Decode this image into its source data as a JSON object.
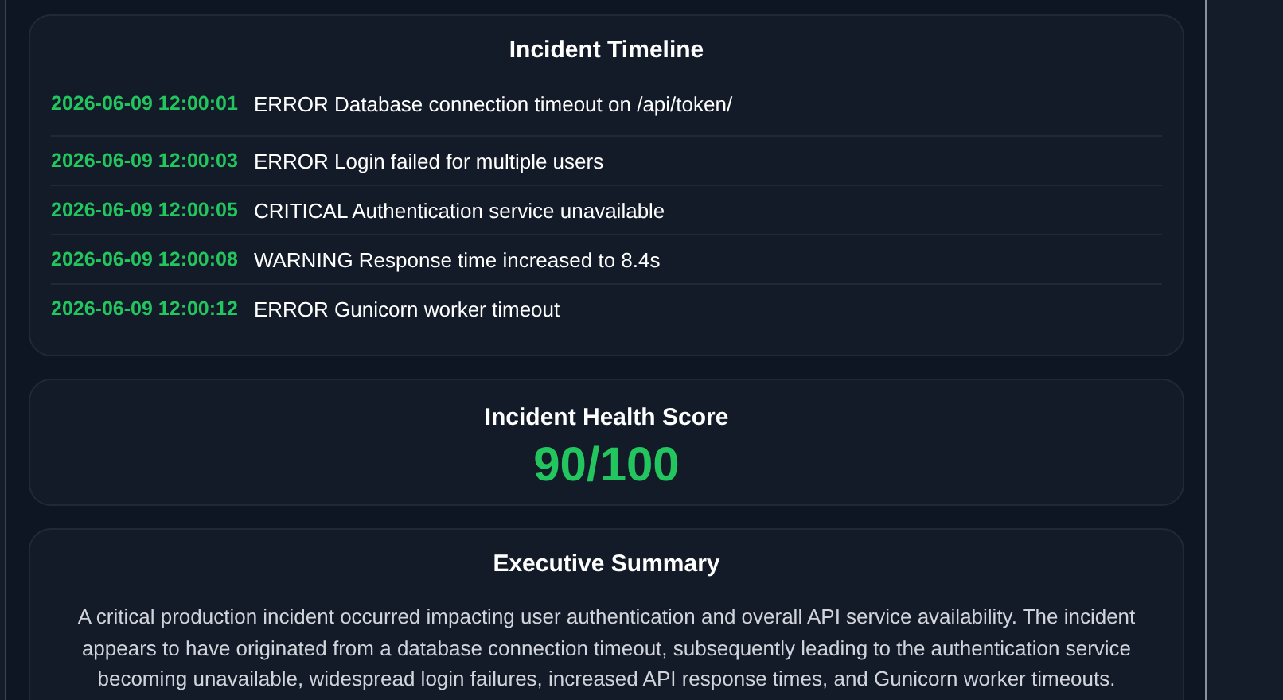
{
  "timeline": {
    "title": "Incident Timeline",
    "events": [
      {
        "time": "2026-06-09 12:00:01",
        "message": "ERROR Database connection timeout on /api/token/"
      },
      {
        "time": "2026-06-09 12:00:03",
        "message": "ERROR Login failed for multiple users"
      },
      {
        "time": "2026-06-09 12:00:05",
        "message": "CRITICAL Authentication service unavailable"
      },
      {
        "time": "2026-06-09 12:00:08",
        "message": "WARNING Response time increased to 8.4s"
      },
      {
        "time": "2026-06-09 12:00:12",
        "message": "ERROR Gunicorn worker timeout"
      }
    ]
  },
  "health": {
    "title": "Incident Health Score",
    "score": "90/100"
  },
  "summary": {
    "title": "Executive Summary",
    "text": "A critical production incident occurred impacting user authentication and overall API service availability. The incident appears to have originated from a database connection timeout, subsequently leading to the authentication service becoming unavailable, widespread login failures, increased API response times, and Gunicorn worker timeouts."
  }
}
